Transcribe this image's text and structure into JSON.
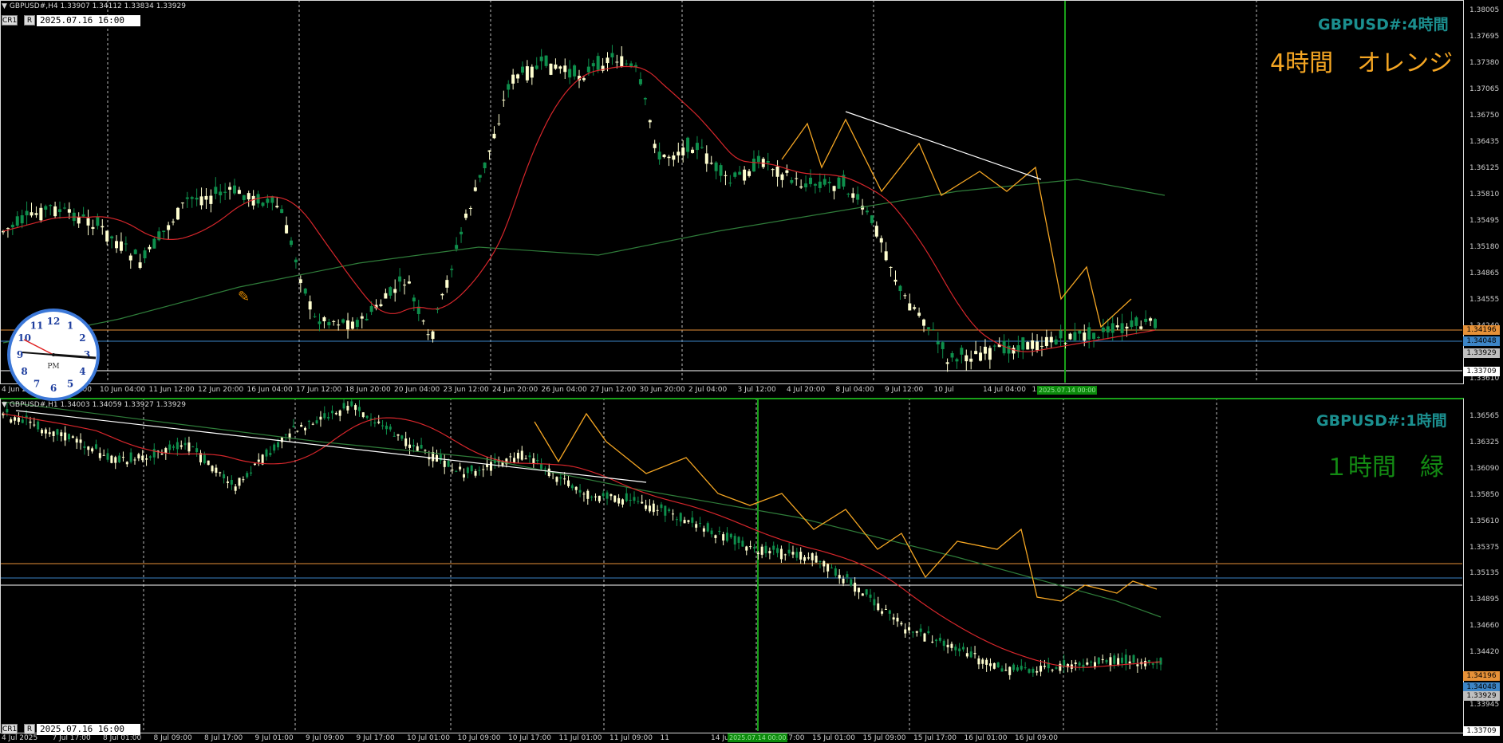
{
  "colors": {
    "background": "#000000",
    "bull_candle": "#0e8f4c",
    "bear_candle": "#ffffd0",
    "ma_fast": "#d6262b",
    "ma_slow": "#2f7d3a",
    "zigzag": "#f5a623",
    "trendline": "#ffffff",
    "level_orange": "#e69138",
    "level_blue": "#3d85c6",
    "level_white": "#ffffff",
    "vline_green": "#19a119",
    "title_teal": "#1b8f8f",
    "note_orange": "#f5a623",
    "note_green": "#138a13"
  },
  "top_pane": {
    "header": "GBPUSD#,H4  1.33907 1.34112 1.33834 1.33929",
    "buttons": [
      "CR1",
      "R"
    ],
    "date_box": "2025.07.16 16:00",
    "title_tag": "GBPUSD#:4時間",
    "note": "4時間　オレンジ",
    "y_labels": [
      "1.38005",
      "1.37695",
      "1.37380",
      "1.37065",
      "1.36750",
      "1.36435",
      "1.36125",
      "1.35810",
      "1.35495",
      "1.35180",
      "1.34865",
      "1.34555",
      "1.34240",
      "1.33925",
      "1.33610"
    ],
    "price_tags": [
      "1.34196",
      "1.34048",
      "1.33929",
      "1.33709"
    ],
    "x_labels": [
      "4 Jun 2025",
      "6 Jun 20:00",
      "10 Jun 04:00",
      "11 Jun 12:00",
      "12 Jun 20:00",
      "16 Jun 04:00",
      "17 Jun 12:00",
      "18 Jun 20:00",
      "20 Jun 04:00",
      "23 Jun 12:00",
      "24 Jun 20:00",
      "26 Jun 04:00",
      "27 Jun 12:00",
      "30 Jun 20:00",
      "2 Jul 04:00",
      "3 Jul 12:00",
      "4 Jul 20:00",
      "8 Jul 04:00",
      "9 Jul 12:00",
      "10 Jul",
      "14 Jul 04:00",
      "15 Jul 12:00"
    ],
    "vline_tag": "2025.07.14 00:00"
  },
  "bottom_pane": {
    "header": "GBPUSD#,H1  1.34003 1.34059 1.33927 1.33929",
    "buttons": [
      "CR1",
      "R"
    ],
    "date_box": "2025.07.16 16:00",
    "title_tag": "GBPUSD#:1時間",
    "note": "１時間　緑",
    "y_labels": [
      "1.36565",
      "1.36325",
      "1.36090",
      "1.35850",
      "1.35610",
      "1.35375",
      "1.35135",
      "1.34895",
      "1.34660",
      "1.34420",
      "1.34180",
      "1.33945",
      "1.33709"
    ],
    "price_tags": [
      "1.34196",
      "1.34048",
      "1.33929",
      "1.33709"
    ],
    "x_labels": [
      "4 Jul 2025",
      "7 Jul 17:00",
      "8 Jul 01:00",
      "8 Jul 09:00",
      "8 Jul 17:00",
      "9 Jul 01:00",
      "9 Jul 09:00",
      "9 Jul 17:00",
      "10 Jul 01:00",
      "10 Jul 09:00",
      "10 Jul 17:00",
      "11 Jul 01:00",
      "11 Jul 09:00",
      "11",
      "14 Jul 09:00",
      "14 Jul 17:00",
      "15 Jul 01:00",
      "15 Jul 09:00",
      "15 Jul 17:00",
      "16 Jul 01:00",
      "16 Jul 09:00"
    ],
    "vline_tag": "2025.07.14 00:00"
  },
  "clock": {
    "label": "PM",
    "numbers": [
      "12",
      "1",
      "2",
      "3",
      "4",
      "5",
      "6",
      "7",
      "8",
      "9",
      "10",
      "11"
    ]
  }
}
